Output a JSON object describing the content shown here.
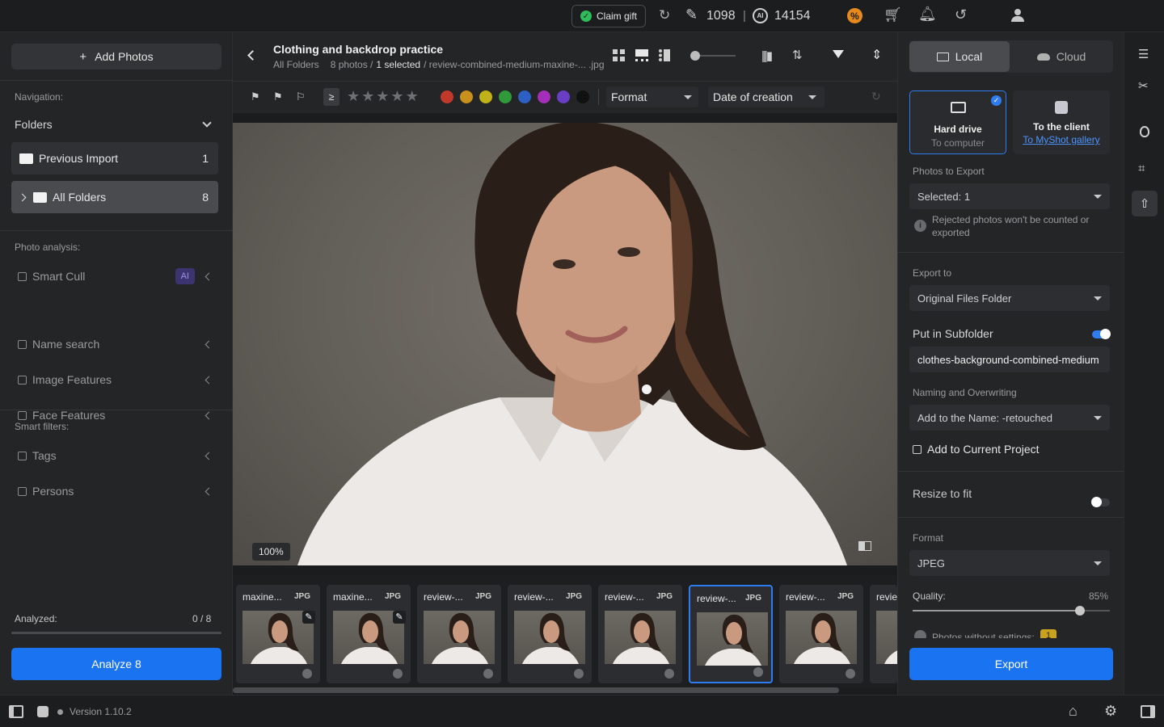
{
  "topbar": {
    "claim_gift": "Claim gift",
    "credits_count": "1098",
    "separator": "|",
    "ai_count": "14154"
  },
  "left": {
    "add_photos": "Add Photos",
    "navigation_label": "Navigation:",
    "folders_label": "Folders",
    "previous_import": {
      "label": "Previous Import",
      "count": "1"
    },
    "all_folders": {
      "label": "All Folders",
      "count": "8"
    },
    "photo_analysis_label": "Photo analysis:",
    "analysis_items": [
      "Smart Cull",
      "Name search",
      "Image Features",
      "Face Features"
    ],
    "ai_badge": "AI",
    "smart_filters_label": "Smart filters:",
    "filter_items": [
      "Tags",
      "Persons"
    ],
    "analyzed_label": "Analyzed:",
    "analyzed_value": "0 / 8",
    "analyze_button": "Analyze 8"
  },
  "center": {
    "title": "Clothing and backdrop practice",
    "breadcrumb_root": "All Folders",
    "photo_count": "8 photos /",
    "selected": "1 selected",
    "filename": "/ review-combined-medium-maxine-... .jpg",
    "compare_symbol": "≥",
    "format_dropdown": "Format",
    "sort_dropdown": "Date of creation",
    "zoom": "100%",
    "color_labels": [
      "#c0392b",
      "#c8901c",
      "#c2b21a",
      "#2e9a3a",
      "#2e5fc4",
      "#a32eb8",
      "#6a3ec4",
      "#111111"
    ],
    "thumbnails": [
      {
        "name": "maxine...",
        "type": "JPG",
        "edited": true,
        "selected": false
      },
      {
        "name": "maxine...",
        "type": "JPG",
        "edited": true,
        "selected": false
      },
      {
        "name": "review-...",
        "type": "JPG",
        "edited": false,
        "selected": false
      },
      {
        "name": "review-...",
        "type": "JPG",
        "edited": false,
        "selected": false
      },
      {
        "name": "review-...",
        "type": "JPG",
        "edited": false,
        "selected": false
      },
      {
        "name": "review-...",
        "type": "JPG",
        "edited": false,
        "selected": true
      },
      {
        "name": "review-...",
        "type": "JPG",
        "edited": false,
        "selected": false
      },
      {
        "name": "revie",
        "type": "",
        "edited": false,
        "selected": false
      }
    ]
  },
  "right": {
    "tab_local": "Local",
    "tab_cloud": "Cloud",
    "hard_drive_title": "Hard drive",
    "hard_drive_sub": "To computer",
    "client_title": "To the client",
    "client_link": "To MyShot gallery",
    "photos_to_export_label": "Photos to Export",
    "photos_to_export_value": "Selected: 1",
    "rejected_note": "Rejected photos won't be counted or exported",
    "export_to_label": "Export to",
    "export_to_value": "Original Files Folder",
    "subfolder_label": "Put in Subfolder",
    "subfolder_on": true,
    "subfolder_value": "clothes-background-combined-medium",
    "naming_label": "Naming and Overwriting",
    "naming_value": "Add to the Name: -retouched",
    "add_to_project": "Add to Current Project",
    "resize_label": "Resize to fit",
    "resize_on": false,
    "format_label": "Format",
    "format_value": "JPEG",
    "quality_label": "Quality:",
    "quality_value": "85%",
    "quality_fraction": 0.85,
    "photos_without_settings": "Photos without settings:",
    "photos_without_settings_count": "1",
    "export_button": "Export"
  },
  "bottom": {
    "version": "Version 1.10.2"
  },
  "colors": {
    "accent": "#1a73f0",
    "panel": "#242527",
    "badge_ai": "#3b3470"
  }
}
